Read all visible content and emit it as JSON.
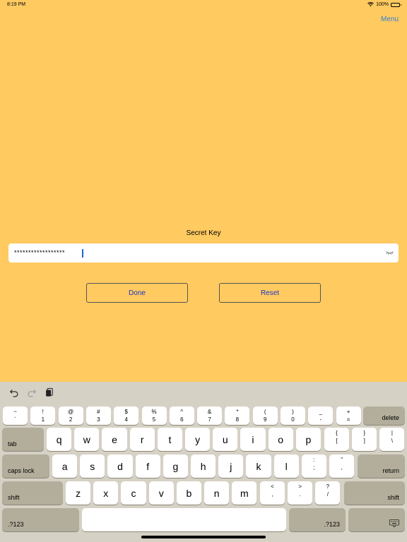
{
  "status": {
    "time": "8:19 PM",
    "battery": "100%"
  },
  "header": {
    "menu_label": "Menu"
  },
  "form": {
    "secret_key_label": "Secret Key",
    "secret_key_value": "******************",
    "done_label": "Done",
    "reset_label": "Reset"
  },
  "keyboard": {
    "number_row": [
      {
        "top": "~",
        "bot": "`"
      },
      {
        "top": "!",
        "bot": "1"
      },
      {
        "top": "@",
        "bot": "2"
      },
      {
        "top": "#",
        "bot": "3"
      },
      {
        "top": "$",
        "bot": "4"
      },
      {
        "top": "%",
        "bot": "5"
      },
      {
        "top": "^",
        "bot": "6"
      },
      {
        "top": "&",
        "bot": "7"
      },
      {
        "top": "*",
        "bot": "8"
      },
      {
        "top": "(",
        "bot": "9"
      },
      {
        "top": ")",
        "bot": "0"
      },
      {
        "top": "_",
        "bot": "-"
      },
      {
        "top": "+",
        "bot": "="
      }
    ],
    "row_q": [
      "q",
      "w",
      "e",
      "r",
      "t",
      "y",
      "u",
      "i",
      "o",
      "p"
    ],
    "row_q_symbols": [
      {
        "top": "{",
        "bot": "["
      },
      {
        "top": "}",
        "bot": "]"
      },
      {
        "top": "|",
        "bot": "\\"
      }
    ],
    "row_a": [
      "a",
      "s",
      "d",
      "f",
      "g",
      "h",
      "j",
      "k",
      "l"
    ],
    "row_a_symbols": [
      {
        "top": ":",
        "bot": ";"
      },
      {
        "top": "\"",
        "bot": ","
      }
    ],
    "row_z": [
      "z",
      "x",
      "c",
      "v",
      "b",
      "n",
      "m"
    ],
    "row_z_symbols": [
      {
        "top": "<",
        "bot": ","
      },
      {
        "top": ">",
        "bot": "."
      },
      {
        "top": "?",
        "bot": "/"
      }
    ],
    "delete_label": "delete",
    "tab_label": "tab",
    "caps_label": "caps lock",
    "return_label": "return",
    "shift_label": "shift",
    "numbers_label": ".?123"
  }
}
